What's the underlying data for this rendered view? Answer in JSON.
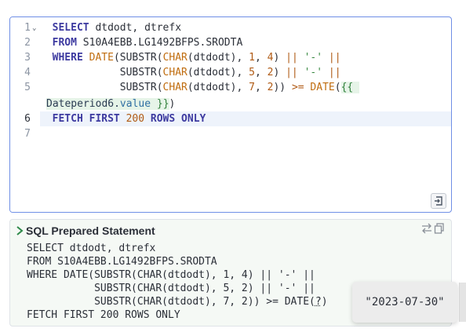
{
  "editor": {
    "line_numbers": [
      "1",
      "2",
      "3",
      "4",
      "5",
      "",
      "6",
      "7"
    ],
    "line1": {
      "kw": "SELECT",
      "rest": " dtdodt, dtrefx"
    },
    "line2": {
      "kw": "FROM",
      "rest": " S10A4EBB.LG1492BFPS.SRODTA"
    },
    "line3": {
      "kw": "WHERE",
      "fn1": "DATE",
      "t1": "(SUBSTR(",
      "fn2": "CHAR",
      "t2": "(dtdodt), ",
      "n1": "1",
      "t3": ", ",
      "n2": "4",
      "t4": ") ",
      "op": "||",
      "t5": " ",
      "str": "'-'",
      "t6": " ",
      "op2": "||"
    },
    "line4": {
      "t0": "SUBSTR(",
      "fn": "CHAR",
      "t1": "(dtdodt), ",
      "n1": "5",
      "t2": ", ",
      "n2": "2",
      "t3": ") ",
      "op": "||",
      "t4": " ",
      "str": "'-'",
      "t5": " ",
      "op2": "||"
    },
    "line5": {
      "t0": "SUBSTR(",
      "fn": "CHAR",
      "t1": "(dtdodt), ",
      "n1": "7",
      "t2": ", ",
      "n2": "2",
      "t3": ")) ",
      "op": ">=",
      "t4": " ",
      "fn2": "DATE",
      "t5": "(",
      "tmpl_open": "{{"
    },
    "line5b": {
      "var": "Dateperiod6",
      "dot": ".",
      "prop": "value",
      "sp": " ",
      "tmpl_close": "}}",
      "close": ")"
    },
    "line6": {
      "kw1": "FETCH",
      "kw2": "FIRST",
      "num": "200",
      "kw3": "ROWS",
      "kw4": "ONLY"
    }
  },
  "prepared": {
    "title": "SQL Prepared Statement",
    "lines": [
      "SELECT dtdodt, dtrefx",
      "FROM S10A4EBB.LG1492BFPS.SRODTA",
      "WHERE DATE(SUBSTR(CHAR(dtdodt), 1, 4) || '-' ||",
      "           SUBSTR(CHAR(dtdodt), 5, 2) || '-' ||",
      "           SUBSTR(CHAR(dtdodt), 7, 2)) >= DATE(",
      "FETCH FIRST 200 ROWS ONLY"
    ],
    "param_marker": "?",
    "line5_close": ")"
  },
  "tooltip": {
    "value": "\"2023-07-30\""
  },
  "colors": {
    "editor_border": "#6f8fe6",
    "keyword": "#3d3aa0",
    "function": "#c06d0f",
    "string": "#3a8a43",
    "template_bg": "#e6f4e8",
    "active_line": "#eef3fb"
  }
}
